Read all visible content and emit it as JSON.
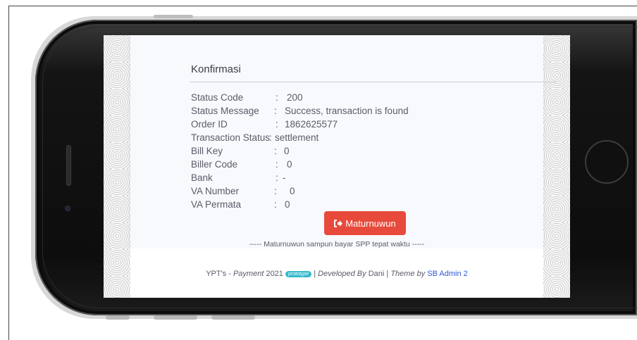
{
  "card": {
    "title": "Konfirmasi",
    "fields": [
      {
        "label": "Status Code",
        "sep": ":",
        "value": "200"
      },
      {
        "label": "Status Message",
        "sep": ":",
        "value": "Success, transaction is found"
      },
      {
        "label": "Order ID",
        "sep": ":",
        "value": "1862625577"
      },
      {
        "label": "Transaction Status",
        "sep": ":",
        "value": "settlement"
      },
      {
        "label": "Bill Key",
        "sep": ":",
        "value": "0"
      },
      {
        "label": "Biller Code",
        "sep": ":",
        "value": "0"
      },
      {
        "label": "Bank",
        "sep": ":",
        "value": "-"
      },
      {
        "label": "VA Number",
        "sep": ":",
        "value": "0"
      },
      {
        "label": "VA Permata",
        "sep": ":",
        "value": "0"
      }
    ],
    "button_label": "Maturnuwun",
    "button_icon": "sign-out-icon",
    "note": "----- Maturnuwun sampun bayar SPP tepat waktu -----"
  },
  "footer": {
    "brand": "YPT's - ",
    "brand_italic": "Payment",
    "year": " 2021 ",
    "badge": "prototype",
    "sep1": " | ",
    "dev_italic": "Developed By",
    "dev_name": " Dani ",
    "sep2": "| ",
    "theme_italic": "Theme by",
    "theme_link": "SB Admin 2"
  },
  "colors": {
    "button": "#e74a3b",
    "badge": "#36b9cc",
    "link": "#2e59d9"
  }
}
